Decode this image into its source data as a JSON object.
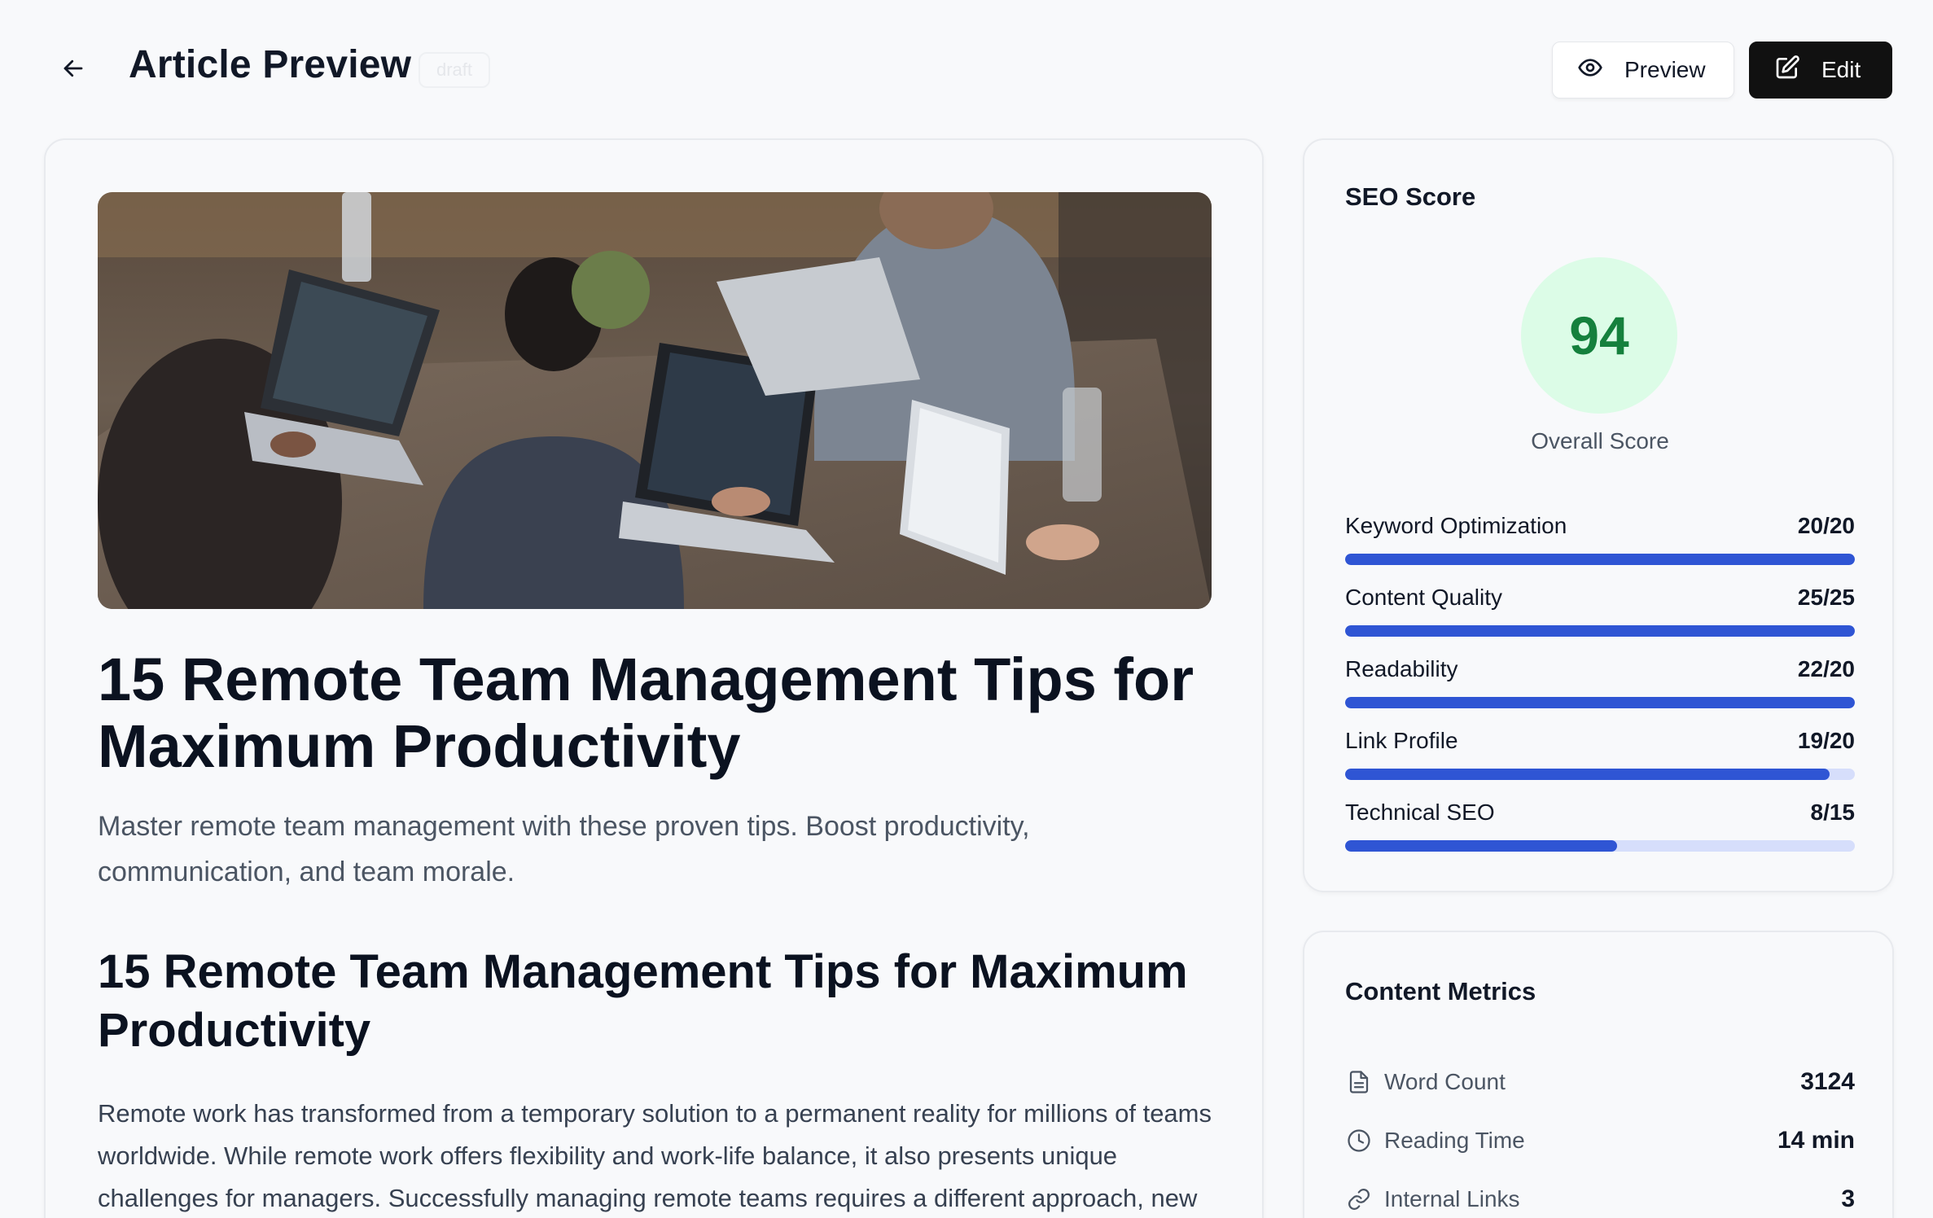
{
  "header": {
    "title": "Article Preview",
    "status": "draft",
    "preview_label": "Preview",
    "edit_label": "Edit"
  },
  "article": {
    "title": "15 Remote Team Management Tips for Maximum Productivity",
    "excerpt": "Master remote team management with these proven tips. Boost productivity, communication, and team morale.",
    "section_heading": "15 Remote Team Management Tips for Maximum Productivity",
    "body": "Remote work has transformed from a temporary solution to a permanent reality for millions of teams worldwide. While remote work offers flexibility and work-life balance, it also presents unique challenges for managers. Successfully managing remote teams requires a different approach, new"
  },
  "seo": {
    "title": "SEO Score",
    "score": "94",
    "score_label": "Overall Score",
    "rows": [
      {
        "label": "Keyword Optimization",
        "value": "20/20",
        "fill": 1.0
      },
      {
        "label": "Content Quality",
        "value": "25/25",
        "fill": 1.0
      },
      {
        "label": "Readability",
        "value": "22/20",
        "fill": 1.0
      },
      {
        "label": "Link Profile",
        "value": "19/20",
        "fill": 0.95
      },
      {
        "label": "Technical SEO",
        "value": "8/15",
        "fill": 0.533
      }
    ]
  },
  "metrics": {
    "title": "Content Metrics",
    "rows": [
      {
        "icon": "document-icon",
        "label": "Word Count",
        "value": "3124"
      },
      {
        "icon": "clock-icon",
        "label": "Reading Time",
        "value": "14 min"
      },
      {
        "icon": "link-icon",
        "label": "Internal Links",
        "value": "3"
      }
    ]
  },
  "colors": {
    "accent": "#2f55d4",
    "track": "#d6defb",
    "score_bg": "#dcfce7",
    "score_text": "#15803d",
    "edit_button": "#111111"
  }
}
